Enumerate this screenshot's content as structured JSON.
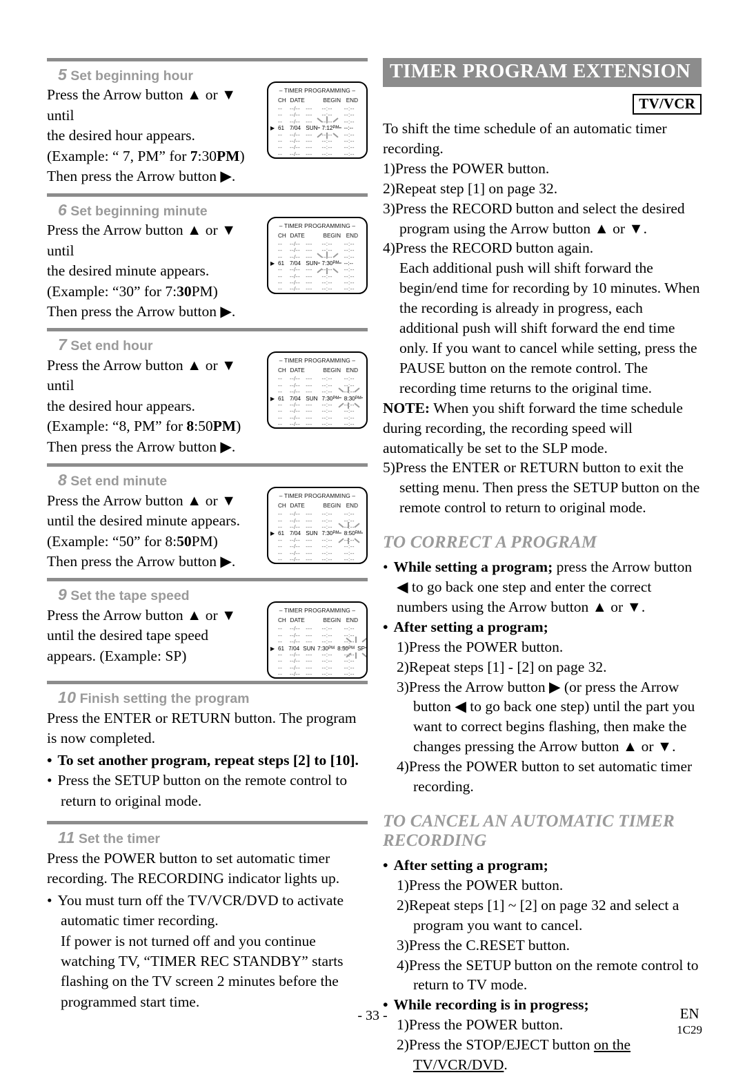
{
  "page": {
    "number": "- 33 -",
    "lang": "EN",
    "code": "1C29",
    "accent_gray": "#8c8c8c",
    "heading_gray": "#9a9a9a"
  },
  "left_column": {
    "steps": [
      {
        "number": "5",
        "title": "Set beginning hour",
        "lines": [
          "Press the Arrow button ▲ or ▼ until",
          "the desired hour appears.",
          "(Example: “ 7, PM” for 7:30PM)",
          "Then press the Arrow button ▶."
        ],
        "osd": {
          "title": "– TIMER PROGRAMMING –",
          "columns": [
            "CH",
            "DATE",
            "BEGIN",
            "END"
          ],
          "active_row": {
            "ch": "61",
            "date": "7/04",
            "day": "SUN",
            "begin": "7:12",
            "begin_ampm": "PM",
            "end": "--:--",
            "end_ampm": "",
            "speed": ""
          },
          "blank_row": {
            "ch": "--",
            "date": "--/--",
            "day": "---",
            "begin": "--:--",
            "end": "--:--",
            "speed": "--"
          },
          "flash_target": "begin-hour"
        }
      },
      {
        "number": "6",
        "title": "Set beginning minute",
        "lines": [
          "Press the Arrow button ▲ or ▼ until",
          "the desired minute appears.",
          "(Example: “30” for 7:30PM)",
          "Then press the Arrow button ▶."
        ],
        "osd": {
          "title": "– TIMER PROGRAMMING –",
          "columns": [
            "CH",
            "DATE",
            "BEGIN",
            "END"
          ],
          "active_row": {
            "ch": "61",
            "date": "7/04",
            "day": "SUN",
            "begin": "7:30",
            "begin_ampm": "PM",
            "end": "--:--",
            "end_ampm": "",
            "speed": ""
          },
          "blank_row": {
            "ch": "--",
            "date": "--/--",
            "day": "---",
            "begin": "--:--",
            "end": "--:--",
            "speed": "--"
          },
          "flash_target": "begin-minute"
        }
      },
      {
        "number": "7",
        "title": "Set end hour",
        "lines": [
          "Press the Arrow button ▲ or ▼ until",
          "the desired hour appears.",
          "(Example: “8, PM” for 8:50PM)",
          "Then press the Arrow button ▶."
        ],
        "osd": {
          "title": "– TIMER PROGRAMMING –",
          "columns": [
            "CH",
            "DATE",
            "BEGIN",
            "END"
          ],
          "active_row": {
            "ch": "61",
            "date": "7/04",
            "day": "SUN",
            "begin": "7:30",
            "begin_ampm": "PM",
            "end": "8:30",
            "end_ampm": "PM",
            "speed": ""
          },
          "blank_row": {
            "ch": "--",
            "date": "--/--",
            "day": "---",
            "begin": "--:--",
            "end": "--:--",
            "speed": "--"
          },
          "flash_target": "end-hour"
        }
      },
      {
        "number": "8",
        "title": "Set end minute",
        "lines": [
          "Press the Arrow button ▲ or ▼",
          "until the desired minute appears.",
          "(Example: “50” for 8:50PM)",
          "Then press the Arrow button ▶."
        ],
        "osd": {
          "title": "– TIMER PROGRAMMING –",
          "columns": [
            "CH",
            "DATE",
            "BEGIN",
            "END"
          ],
          "active_row": {
            "ch": "61",
            "date": "7/04",
            "day": "SUN",
            "begin": "7:30",
            "begin_ampm": "PM",
            "end": "8:50",
            "end_ampm": "PM",
            "speed": ""
          },
          "blank_row": {
            "ch": "--",
            "date": "--/--",
            "day": "---",
            "begin": "--:--",
            "end": "--:--",
            "speed": "--"
          },
          "flash_target": "end-minute"
        }
      },
      {
        "number": "9",
        "title": "Set the tape speed",
        "lines": [
          "Press the Arrow button ▲ or ▼",
          "until the desired tape speed",
          "appears. (Example: SP)"
        ],
        "osd": {
          "title": "– TIMER PROGRAMMING –",
          "columns": [
            "CH",
            "DATE",
            "BEGIN",
            "END"
          ],
          "active_row": {
            "ch": "61",
            "date": "7/04",
            "day": "SUN",
            "begin": "7:30",
            "begin_ampm": "PM",
            "end": "8:50",
            "end_ampm": "PM",
            "speed": "SP"
          },
          "blank_row": {
            "ch": "--",
            "date": "--/--",
            "day": "---",
            "begin": "--:--",
            "end": "--:--",
            "speed": "--"
          },
          "flash_target": "speed"
        }
      }
    ],
    "step10": {
      "number": "10",
      "title": "Finish setting the program",
      "para": "Press the ENTER or RETURN button. The program is now completed.",
      "bullet_bold": "To set another program, repeat steps [2] to [10].",
      "bullet_plain": "Press the SETUP button on the remote control to return to original mode."
    },
    "step11": {
      "number": "11",
      "title": "Set the timer",
      "para": "Press the POWER button to set automatic timer recording. The RECORDING indicator lights up.",
      "bullet": "You must turn off the TV/VCR/DVD to activate automatic timer recording.",
      "note": "If power is not turned off and you continue watching TV, “TIMER REC STANDBY” starts flashing on the TV screen 2 minutes before the programmed start time."
    }
  },
  "right_column": {
    "title": "TIMER PROGRAM EXTENSION",
    "badge": "TV/VCR",
    "intro": "To shift the time schedule of an automatic timer recording.",
    "steps": [
      "1)Press the POWER button.",
      "2)Repeat step [1] on page 32.",
      "3)Press the RECORD button and select the desired program using the Arrow button ▲ or ▼.",
      "4)Press the RECORD button again."
    ],
    "step4_detail": "Each additional push will shift forward the begin/end time for recording by 10 minutes. When the recording is already in progress, each additional push will shift forward the end time only. If you want to cancel while setting, press the PAUSE button on the remote control. The recording time returns to the original time.",
    "note_label": "NOTE:",
    "note_text": " When you shift forward the time schedule during recording, the recording speed will automatically be set to the SLP mode.",
    "step5": "5)Press the ENTER or RETURN button to exit the setting menu. Then press the SETUP button on the remote control to return to original mode.",
    "section_correct": {
      "heading": "TO CORRECT A PROGRAM",
      "bullet1_bold": "While setting a program;",
      "bullet1_rest": " press the Arrow button ◀ to go back one step and enter the correct numbers using the Arrow button ▲ or ▼.",
      "bullet2_bold": "After setting a program;",
      "items": [
        "1)Press the POWER button.",
        "2)Repeat steps [1] - [2] on page 32.",
        "3)Press the Arrow button ▶ (or press the Arrow button ◀ to go back one step) until the part you want to correct begins flashing, then make the changes pressing the Arrow button ▲ or ▼.",
        "4)Press the POWER button to set automatic timer recording."
      ]
    },
    "section_cancel": {
      "heading": "TO CANCEL AN AUTOMATIC TIMER RECORDING",
      "bullet1_bold": "After setting a program;",
      "items1": [
        "1)Press the POWER button.",
        "2)Repeat steps [1] ~ [2] on page 32 and select a program you want to cancel.",
        "3)Press the C.RESET button.",
        "4)Press the SETUP button on the remote control to return to TV mode."
      ],
      "bullet2_bold": "While recording is in progress;",
      "items2_first": "1)Press the POWER button.",
      "items2_second_pre": "2)Press the STOP/EJECT button ",
      "items2_second_underline": "on the TV/VCR/DVD",
      "items2_second_post": "."
    }
  }
}
